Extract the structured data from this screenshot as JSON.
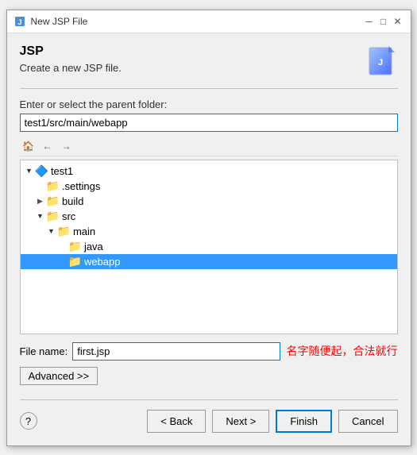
{
  "window": {
    "title": "New JSP File",
    "icon": "jsp-icon"
  },
  "header": {
    "title": "JSP",
    "subtitle": "Create a new JSP file.",
    "icon": "wizard-icon"
  },
  "form": {
    "folder_label": "Enter or select the parent folder:",
    "folder_value": "test1/src/main/webapp",
    "file_name_label": "File name:",
    "file_name_value": "first.jsp",
    "annotation": "名字随便起，合法就行"
  },
  "tree": {
    "items": [
      {
        "id": "test1",
        "label": "test1",
        "type": "project",
        "indent": 0,
        "expanded": true,
        "arrow": "▼"
      },
      {
        "id": "settings",
        "label": ".settings",
        "type": "folder",
        "indent": 1,
        "expanded": false,
        "arrow": ""
      },
      {
        "id": "build",
        "label": "build",
        "type": "folder",
        "indent": 1,
        "expanded": false,
        "arrow": "▶"
      },
      {
        "id": "src",
        "label": "src",
        "type": "folder",
        "indent": 1,
        "expanded": true,
        "arrow": "▼"
      },
      {
        "id": "main",
        "label": "main",
        "type": "folder",
        "indent": 2,
        "expanded": true,
        "arrow": "▼"
      },
      {
        "id": "java",
        "label": "java",
        "type": "folder",
        "indent": 3,
        "expanded": false,
        "arrow": ""
      },
      {
        "id": "webapp",
        "label": "webapp",
        "type": "folder",
        "indent": 3,
        "expanded": false,
        "arrow": "",
        "selected": true
      }
    ]
  },
  "toolbar": {
    "back_icon": "←",
    "forward_icon": "→",
    "up_icon": "↑"
  },
  "buttons": {
    "advanced_label": "Advanced >>",
    "back_label": "< Back",
    "next_label": "Next >",
    "finish_label": "Finish",
    "cancel_label": "Cancel",
    "help_label": "?"
  }
}
